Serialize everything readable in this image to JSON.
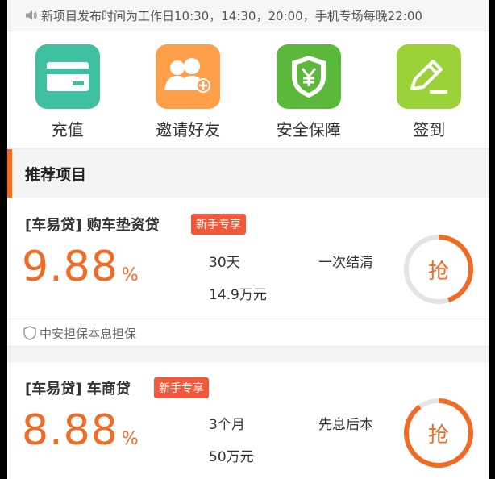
{
  "notice": {
    "text": "新项目发布时间为工作日10:30，14:30，20:00，手机专场每晚22:00"
  },
  "actions": [
    {
      "label": "充值",
      "icon": "card-icon",
      "color": "#3ebfa0"
    },
    {
      "label": "邀请好友",
      "icon": "invite-friends-icon",
      "color": "#ff9f4a"
    },
    {
      "label": "安全保障",
      "icon": "shield-yen-icon",
      "color": "#5cb83a"
    },
    {
      "label": "签到",
      "icon": "pen-sign-icon",
      "color": "#9bd23a"
    }
  ],
  "section": {
    "title": "推荐项目"
  },
  "projects": [
    {
      "title": "[车易贷] 购车垫资贷",
      "badge": "新手专享",
      "rate": "9.88",
      "rate_unit": "%",
      "term": "30天",
      "amount": "14.9万元",
      "repayment": "一次结清",
      "grab_label": "抢",
      "progress": 0.45,
      "guarantee": "中安担保本息担保"
    },
    {
      "title": "[车易贷] 车商贷",
      "badge": "新手专享",
      "rate": "8.88",
      "rate_unit": "%",
      "term": "3个月",
      "amount": "50万元",
      "repayment": "先息后本",
      "grab_label": "抢",
      "progress": 0.9
    }
  ],
  "colors": {
    "accent": "#f26a24",
    "badge": "#f2583a"
  }
}
